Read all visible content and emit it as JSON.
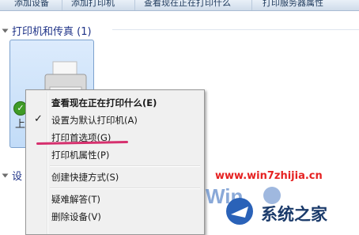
{
  "toolbar": {
    "items": [
      "添加设备",
      "添加打印机",
      "查看现在正在打印什么",
      "打印服务器属性"
    ]
  },
  "groups": {
    "printers_title": "打印机和传真 (1)",
    "devices_title_partial": "设"
  },
  "tile": {
    "partial_label": "上"
  },
  "context_menu": {
    "items": [
      {
        "label": "查看现在正在打印什么(E)",
        "bold": true,
        "checked": false
      },
      {
        "label": "设置为默认打印机(A)",
        "bold": false,
        "checked": true
      },
      {
        "label": "打印首选项(G)",
        "bold": false,
        "checked": false
      },
      {
        "label": "打印机属性(P)",
        "bold": false,
        "checked": false
      },
      {
        "label": "创建快捷方式(S)",
        "bold": false,
        "checked": false
      },
      {
        "label": "疑难解答(T)",
        "bold": false,
        "checked": false
      },
      {
        "label": "删除设备(V)",
        "bold": false,
        "checked": false
      }
    ],
    "check_glyph": "✓"
  },
  "watermark": {
    "url": "www.win7zhijia.cn",
    "brand": "系统之家",
    "colors": {
      "url": "#e62121",
      "brand": "#1a3a6a"
    }
  },
  "colors": {
    "selection": "#c2dcf8",
    "highlight_mark": "#d6306e"
  }
}
